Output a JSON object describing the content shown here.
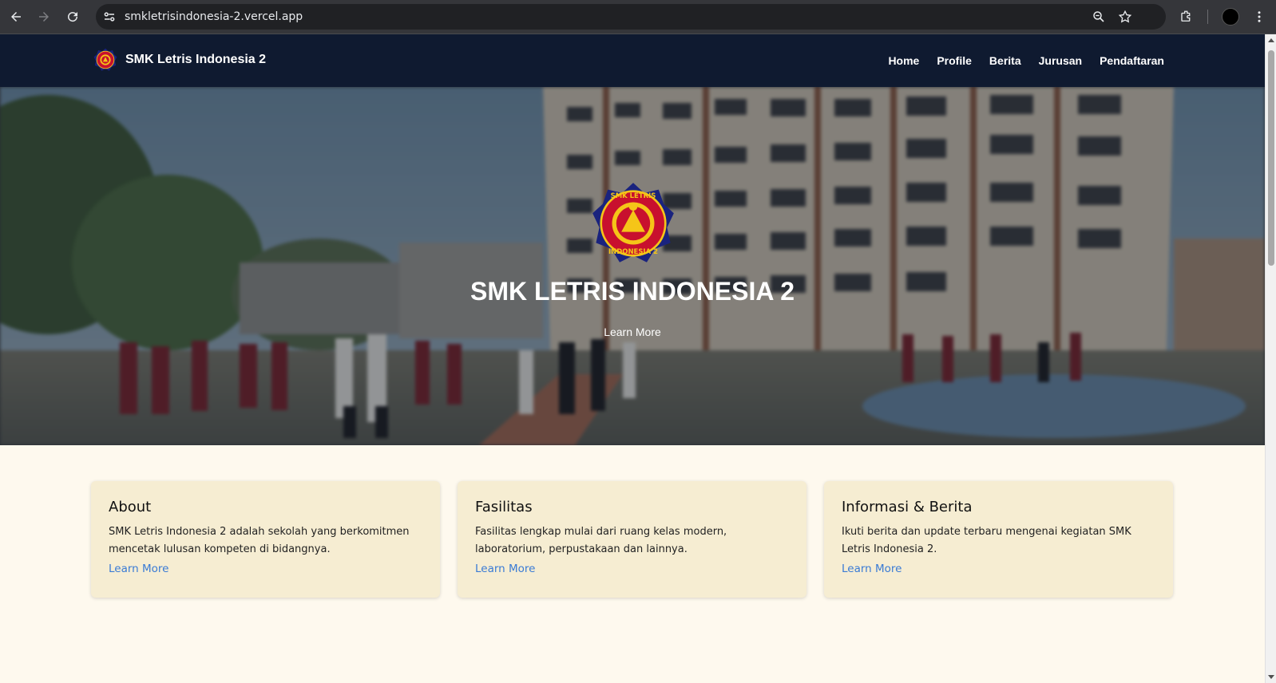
{
  "browser": {
    "url": "smkletrisindonesia-2.vercel.app",
    "icons": [
      "back-arrow-icon",
      "forward-arrow-icon",
      "reload-icon",
      "site-settings-icon",
      "zoom-icon",
      "bookmark-star-icon",
      "extensions-icon",
      "profile-avatar",
      "menu-dots-icon"
    ]
  },
  "nav": {
    "brand": "SMK Letris Indonesia 2",
    "items": [
      {
        "label": "Home"
      },
      {
        "label": "Profile"
      },
      {
        "label": "Berita"
      },
      {
        "label": "Jurusan"
      },
      {
        "label": "Pendaftaran"
      }
    ]
  },
  "hero": {
    "title": "SMK LETRIS INDONESIA 2",
    "cta": "Learn More"
  },
  "cards": [
    {
      "title": "About",
      "text": "SMK Letris Indonesia 2 adalah sekolah yang berkomitmen mencetak lulusan kompeten di bidangnya.",
      "link": "Learn More"
    },
    {
      "title": "Fasilitas",
      "text": "Fasilitas lengkap mulai dari ruang kelas modern, laboratorium, perpustakaan dan lainnya.",
      "link": "Learn More"
    },
    {
      "title": "Informasi & Berita",
      "text": "Ikuti berita dan update terbaru mengenai kegiatan SMK Letris Indonesia 2.",
      "link": "Learn More"
    }
  ],
  "colors": {
    "navbar": "#0f1a30",
    "page_bg": "#fef9ee",
    "card_bg": "#f6edd2",
    "link": "#3a7bd5",
    "logo_red": "#c8102e",
    "logo_blue": "#1a237e",
    "logo_gold": "#f5c518"
  }
}
